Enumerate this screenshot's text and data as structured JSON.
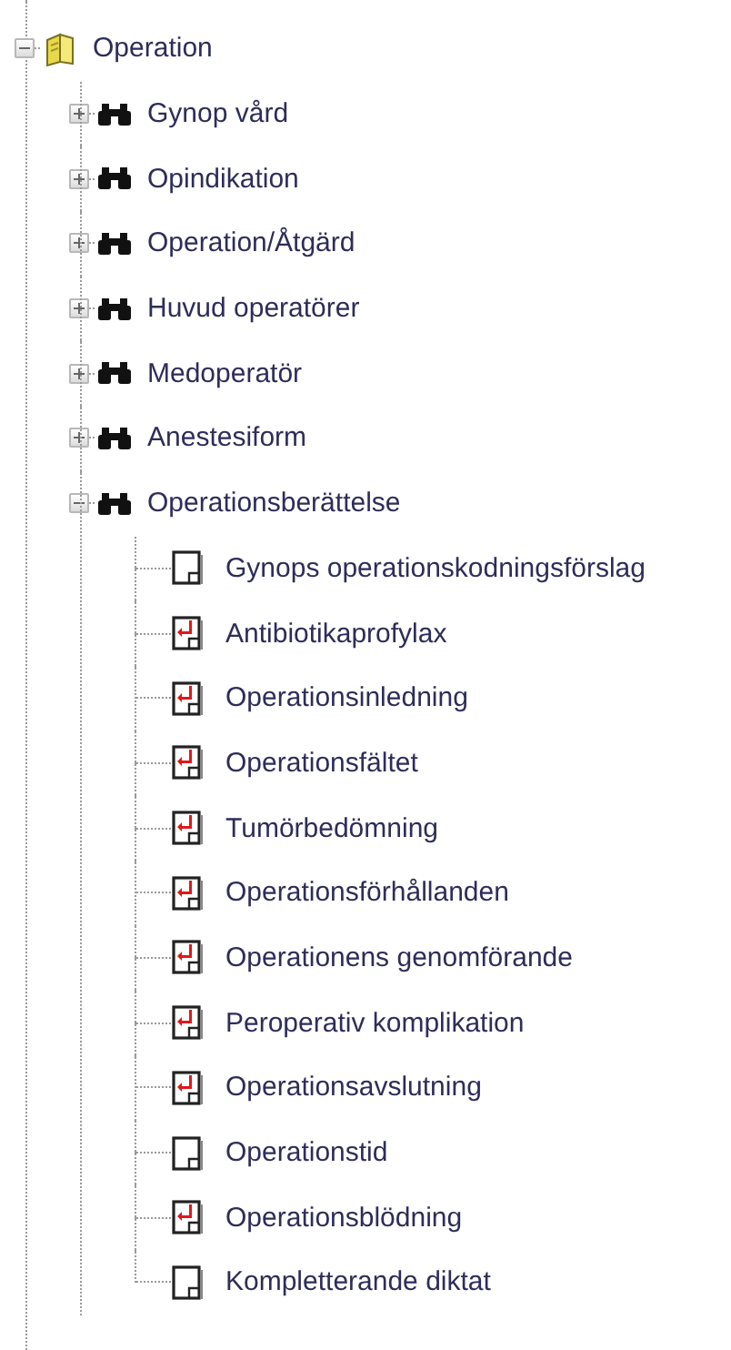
{
  "tree": {
    "more_below": true,
    "nodes": [
      {
        "label": "Operation",
        "kind": "folder",
        "expanded": true,
        "more_below": true,
        "children": [
          {
            "label": "Gynop vård",
            "kind": "binoculars",
            "expanded": false
          },
          {
            "label": "Opindikation",
            "kind": "binoculars",
            "expanded": false
          },
          {
            "label": "Operation/Åtgärd",
            "kind": "binoculars",
            "expanded": false
          },
          {
            "label": "Huvud operatörer",
            "kind": "binoculars",
            "expanded": false
          },
          {
            "label": "Medoperatör",
            "kind": "binoculars",
            "expanded": false
          },
          {
            "label": "Anestesiform",
            "kind": "binoculars",
            "expanded": false
          },
          {
            "label": "Operationsberättelse",
            "kind": "binoculars",
            "expanded": true,
            "children": [
              {
                "label": "Gynops operationskodningsförslag",
                "kind": "document",
                "flagged": false
              },
              {
                "label": "Antibiotikaprofylax",
                "kind": "document",
                "flagged": true
              },
              {
                "label": "Operationsinledning",
                "kind": "document",
                "flagged": true
              },
              {
                "label": "Operationsfältet",
                "kind": "document",
                "flagged": true
              },
              {
                "label": "Tumörbedömning",
                "kind": "document",
                "flagged": true
              },
              {
                "label": "Operationsförhållanden",
                "kind": "document",
                "flagged": true
              },
              {
                "label": "Operationens genomförande",
                "kind": "document",
                "flagged": true
              },
              {
                "label": "Peroperativ komplikation",
                "kind": "document",
                "flagged": true
              },
              {
                "label": "Operationsavslutning",
                "kind": "document",
                "flagged": true
              },
              {
                "label": "Operationstid",
                "kind": "document",
                "flagged": false
              },
              {
                "label": "Operationsblödning",
                "kind": "document",
                "flagged": true
              },
              {
                "label": "Kompletterande diktat",
                "kind": "document",
                "flagged": false
              }
            ]
          }
        ]
      }
    ]
  }
}
